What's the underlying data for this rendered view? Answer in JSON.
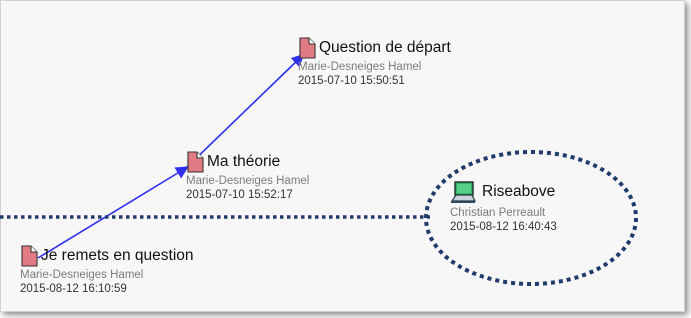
{
  "notes": [
    {
      "title": "Question de départ",
      "author": "Marie-Desneiges Hamel",
      "date": "2015-07-10 15:50:51",
      "icon": "note-document-icon"
    },
    {
      "title": "Ma théorie",
      "author": "Marie-Desneiges Hamel",
      "date": "2015-07-10 15:52:17",
      "icon": "note-document-icon"
    },
    {
      "title": "Je remets en question",
      "author": "Marie-Desneiges Hamel",
      "date": "2015-08-12 16:10:59",
      "icon": "note-document-icon"
    }
  ],
  "riseabove": {
    "title": "Riseabove",
    "author": "Christian Perreault",
    "date": "2015-08-12 16:40:43",
    "icon": "riseabove-laptop-icon"
  },
  "colors": {
    "build_on_link": "#2f2ff0",
    "annotation_dots": "#1f3a6b",
    "note_icon_fill": "#e37b84",
    "riseabove_icon": "#2fb06a"
  }
}
